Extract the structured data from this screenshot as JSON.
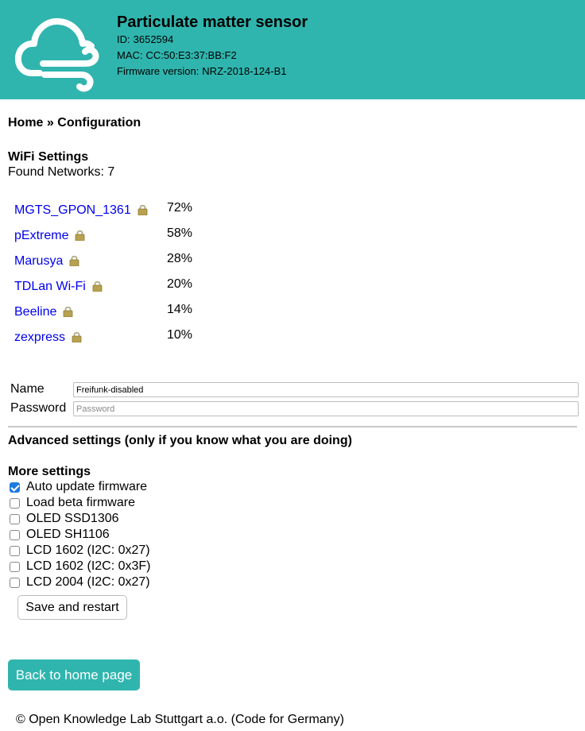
{
  "theme": {
    "accent": "#2fb5ae",
    "link_color": "#0000ee",
    "checkbox_color": "#1f7ae0"
  },
  "header": {
    "logo_icon": "cloud-wind-icon",
    "title": "Particulate matter sensor",
    "id_label": "ID:",
    "id_value": "3652594",
    "mac_label": "MAC:",
    "mac_value": "CC:50:E3:37:BB:F2",
    "fw_label": "Firmware version:",
    "fw_value": "NRZ-2018-124-B1"
  },
  "breadcrumb": {
    "home": "Home",
    "separator": "»",
    "current": "Configuration"
  },
  "wifi": {
    "title": "WiFi Settings",
    "found_label": "Found Networks:",
    "found_count": "7",
    "networks": [
      {
        "name": "MGTS_GPON_1361",
        "signal": "72%",
        "icon": "lock-icon"
      },
      {
        "name": "pExtreme",
        "signal": "58%",
        "icon": "lock-icon"
      },
      {
        "name": "Marusya",
        "signal": "28%",
        "icon": "lock-icon"
      },
      {
        "name": "TDLan Wi-Fi",
        "signal": "20%",
        "icon": "lock-icon"
      },
      {
        "name": "Beeline",
        "signal": "14%",
        "icon": "lock-icon"
      },
      {
        "name": "zexpress",
        "signal": "10%",
        "icon": "lock-icon"
      }
    ]
  },
  "form": {
    "name_label": "Name",
    "name_value": "Freifunk-disabled",
    "name_placeholder": "",
    "password_label": "Password",
    "password_value": "",
    "password_placeholder": "Password"
  },
  "advanced": {
    "title": "Advanced settings (only if you know what you are doing)"
  },
  "more": {
    "title": "More settings",
    "options": [
      {
        "label": "Auto update firmware",
        "checked": true
      },
      {
        "label": "Load beta firmware",
        "checked": false
      },
      {
        "label": "OLED SSD1306",
        "checked": false
      },
      {
        "label": "OLED SH1106",
        "checked": false
      },
      {
        "label": "LCD 1602 (I2C: 0x27)",
        "checked": false
      },
      {
        "label": "LCD 1602 (I2C: 0x3F)",
        "checked": false
      },
      {
        "label": "LCD 2004 (I2C: 0x27)",
        "checked": false
      }
    ],
    "save_label": "Save and restart"
  },
  "nav": {
    "home_button": "Back to home page"
  },
  "footer": {
    "text": "© Open Knowledge Lab Stuttgart a.o. (Code for Germany)"
  }
}
